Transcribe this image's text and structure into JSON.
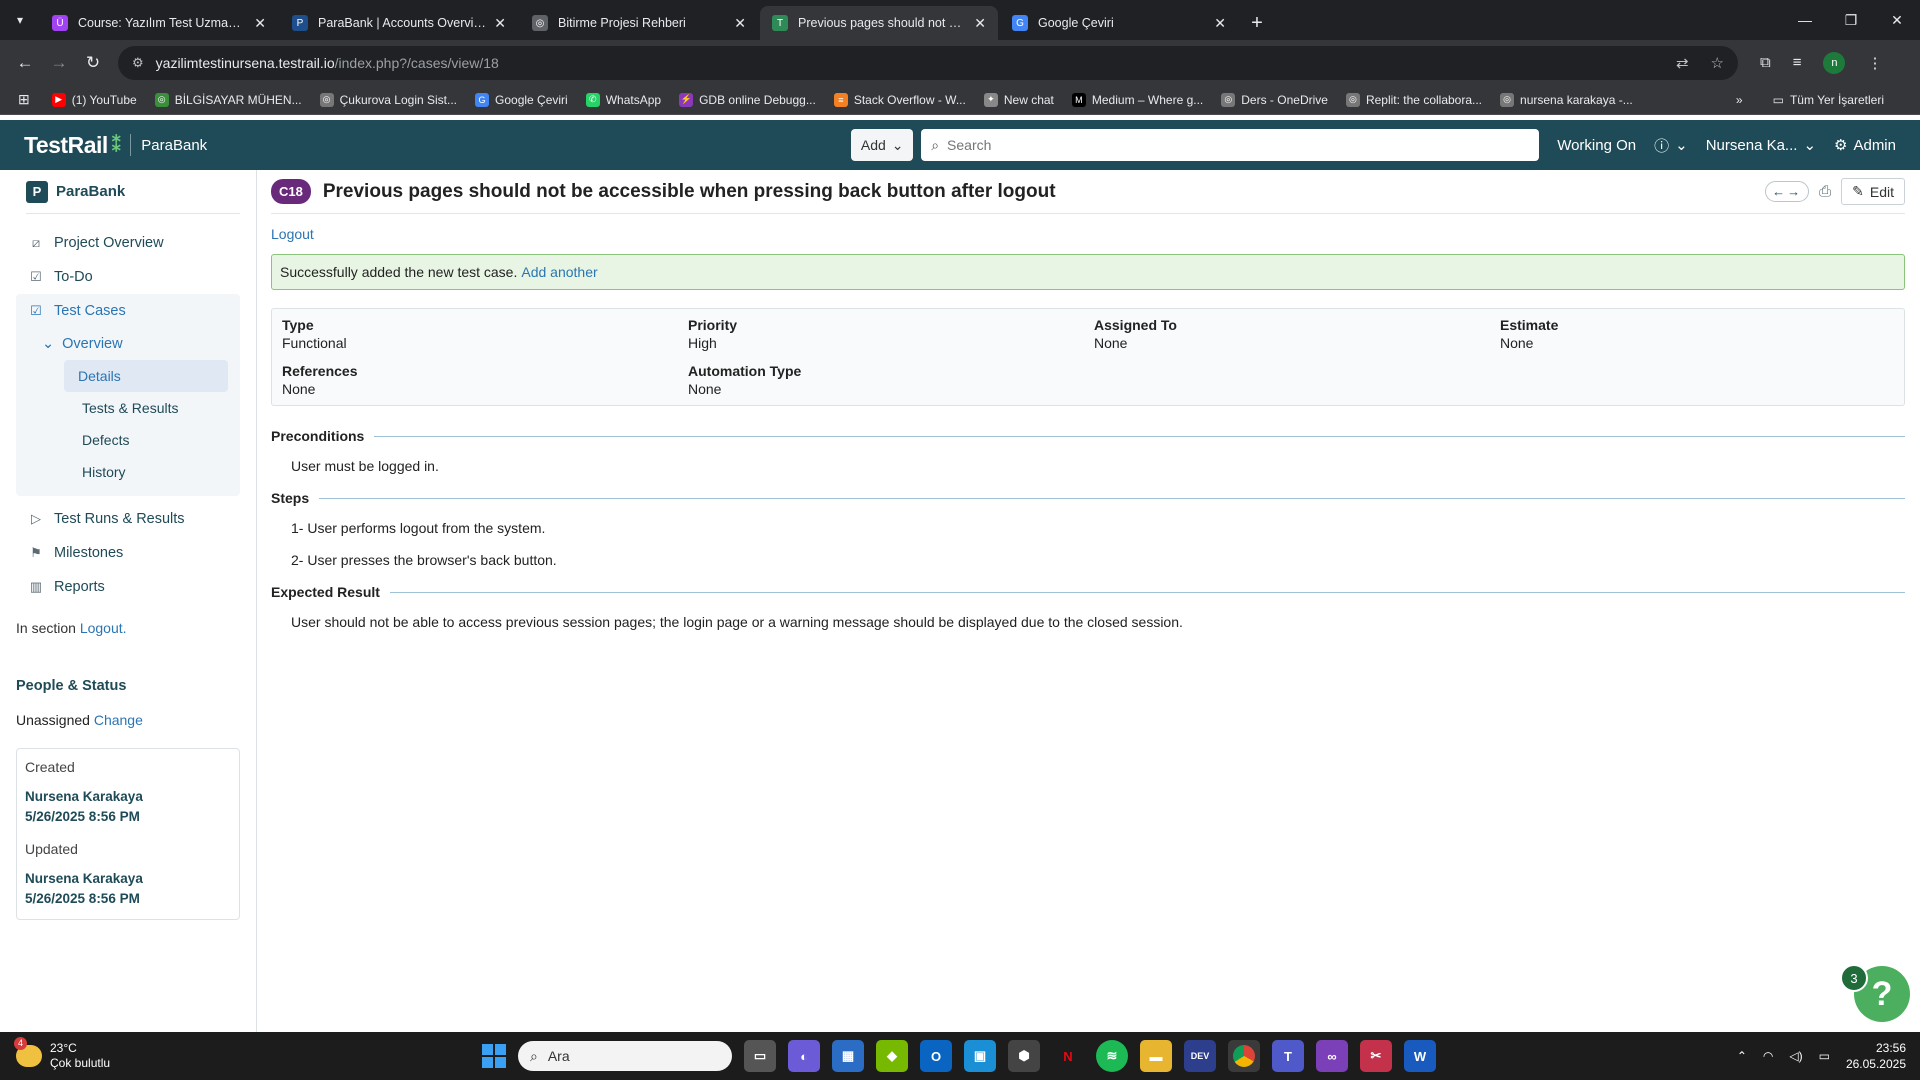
{
  "browser": {
    "tabs": [
      {
        "title": "Course: Yazılım Test Uzmanlığı I",
        "favicon_color": "#a142f4",
        "favicon_glyph": "Ü"
      },
      {
        "title": "ParaBank | Accounts Overview",
        "favicon_color": "#1e4e8c",
        "favicon_glyph": "P"
      },
      {
        "title": "Bitirme Projesi Rehberi",
        "favicon_color": "#5f6368",
        "favicon_glyph": "◎"
      },
      {
        "title": "Previous pages should not be a",
        "favicon_color": "#2e8b57",
        "favicon_glyph": "T"
      },
      {
        "title": "Google Çeviri",
        "favicon_color": "#4285f4",
        "favicon_glyph": "G"
      }
    ],
    "active_tab": 3,
    "url_host": "yazilimtestinursena.testrail.io",
    "url_path": "/index.php?/cases/view/18",
    "profile_initial": "n",
    "bookmarks": [
      {
        "label": "(1) YouTube",
        "color": "#ff0000"
      },
      {
        "label": "BİLGİSAYAR MÜHEN...",
        "color": "#3a8f3a"
      },
      {
        "label": "Çukurova Login Sist...",
        "color": "#777777"
      },
      {
        "label": "Google Çeviri",
        "color": "#4285f4"
      },
      {
        "label": "WhatsApp",
        "color": "#25d366"
      },
      {
        "label": "GDB online Debugg...",
        "color": "#8a3ab9"
      },
      {
        "label": "Stack Overflow - W...",
        "color": "#f48024"
      },
      {
        "label": "New chat",
        "color": "#888888"
      },
      {
        "label": "Medium – Where g...",
        "color": "#000000"
      },
      {
        "label": "Ders - OneDrive",
        "color": "#777777"
      },
      {
        "label": "Replit: the collabora...",
        "color": "#777777"
      },
      {
        "label": "nursena karakaya -...",
        "color": "#777777"
      }
    ],
    "all_bookmarks_label": "Tüm Yer İşaretleri"
  },
  "header": {
    "logo": "TestRail",
    "project": "ParaBank",
    "add_label": "Add",
    "search_placeholder": "Search",
    "working_on": "Working On",
    "user": "Nursena Ka...",
    "admin": "Admin"
  },
  "sidebar": {
    "project_initial": "P",
    "project_name": "ParaBank",
    "nav": {
      "project_overview": "Project Overview",
      "todo": "To-Do",
      "test_cases": "Test Cases",
      "overview": "Overview",
      "details": "Details",
      "tests_results": "Tests & Results",
      "defects": "Defects",
      "history": "History",
      "test_runs": "Test Runs & Results",
      "milestones": "Milestones",
      "reports": "Reports"
    },
    "section_prefix": "In section",
    "section_link": "Logout.",
    "people_status": "People & Status",
    "unassigned": "Unassigned",
    "change": "Change",
    "created_label": "Created",
    "created_by": "Nursena Karakaya",
    "created_at": "5/26/2025 8:56 PM",
    "updated_label": "Updated",
    "updated_by": "Nursena Karakaya",
    "updated_at": "5/26/2025 8:56 PM"
  },
  "main": {
    "case_id": "C18",
    "title": "Previous pages should not be accessible when pressing back button after logout",
    "edit_label": "Edit",
    "breadcrumb": "Logout",
    "alert_text": "Successfully added the new test case.",
    "alert_link": "Add another",
    "props": {
      "type_label": "Type",
      "type_value": "Functional",
      "priority_label": "Priority",
      "priority_value": "High",
      "assigned_label": "Assigned To",
      "assigned_value": "None",
      "estimate_label": "Estimate",
      "estimate_value": "None",
      "references_label": "References",
      "references_value": "None",
      "automation_label": "Automation Type",
      "automation_value": "None"
    },
    "preconditions_heading": "Preconditions",
    "preconditions": "User must be logged in.",
    "steps_heading": "Steps",
    "steps": [
      "1- User performs logout from the system.",
      "2- User presses the browser's back button."
    ],
    "expected_heading": "Expected Result",
    "expected": "User should not be able to access previous session pages; the login page or a warning message should be displayed due to the closed session."
  },
  "help": {
    "count": "3",
    "glyph": "?"
  },
  "taskbar": {
    "temp": "23°C",
    "weather": "Çok bulutlu",
    "weather_badge": "4",
    "search_placeholder": "Ara",
    "time": "23:56",
    "date": "26.05.2025"
  },
  "colors": {
    "header_bg": "#1f4a57",
    "link": "#2a75b3",
    "case_badge": "#6a2a7c",
    "success_bg": "#e9f5e4",
    "help": "#4caf5f"
  }
}
